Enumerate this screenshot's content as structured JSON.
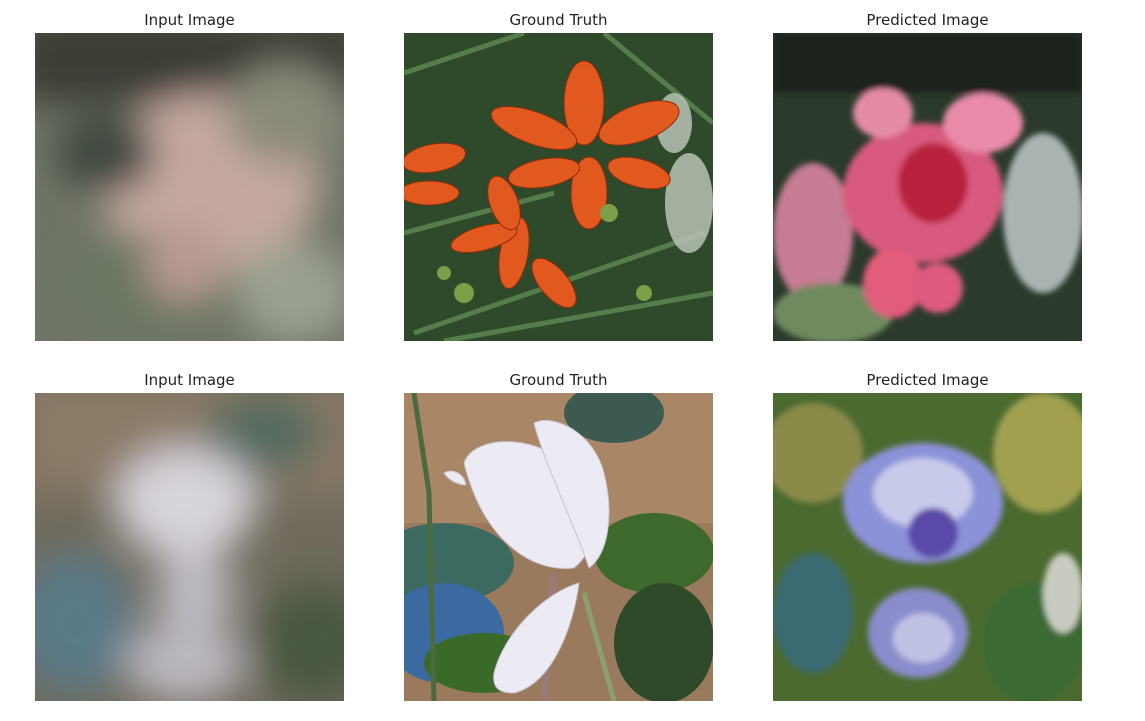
{
  "rows": [
    {
      "panels": [
        {
          "title": "Input Image",
          "image": "blurred-lily-input"
        },
        {
          "title": "Ground Truth",
          "image": "orange-spotted-lily-photo"
        },
        {
          "title": "Predicted Image",
          "image": "pink-flower-prediction"
        }
      ]
    },
    {
      "panels": [
        {
          "title": "Input Image",
          "image": "blurred-cyclamen-input"
        },
        {
          "title": "Ground Truth",
          "image": "white-cyclamen-photo"
        },
        {
          "title": "Predicted Image",
          "image": "blue-flower-prediction"
        }
      ]
    }
  ]
}
